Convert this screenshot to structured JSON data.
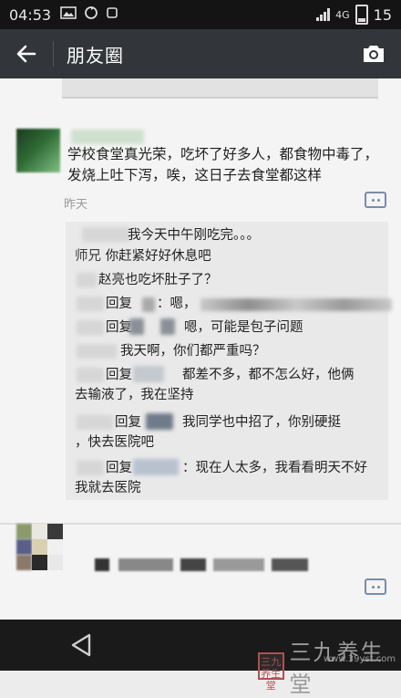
{
  "status_bar": {
    "time": "04:53",
    "battery": "15"
  },
  "action_bar": {
    "title": "朋友圈"
  },
  "post": {
    "text": "学校食堂真光荣，吃坏了好多人，都食物中毒了，发烧上吐下泻，唉，这日子去食堂都这样",
    "time": "昨天",
    "comments": [
      {
        "text": "我今天中午刚吃完。。。"
      },
      {
        "user": "师兄",
        "text": "你赶紧好好休息吧"
      },
      {
        "text": "赵亮也吃坏肚子了？"
      },
      {
        "reply": "回复",
        "text": "：嗯，"
      },
      {
        "reply": "回复",
        "text": "嗯，可能是包子问题"
      },
      {
        "text": "我天啊，你们都严重吗？"
      },
      {
        "reply": "回复",
        "text": "都差不多，都不怎么好，他俩"
      },
      {
        "text": "去输液了，我在坚持"
      },
      {
        "reply": "回复",
        "text": "我同学也中招了，你别硬挺"
      },
      {
        "text": "，快去医院吧"
      },
      {
        "reply": "回复",
        "text": "：现在人太多，我看看明天不好"
      },
      {
        "text": "我就去医院"
      }
    ]
  },
  "watermark": {
    "badge": "三九养生堂",
    "text": "三九养生堂",
    "url": "www.39yst.com"
  },
  "colors": {
    "status_bar_bg": "#141414",
    "action_bar_bg": "#323539",
    "comment_box_bg": "#e9e9e9",
    "link_blue": "#7a8ca8"
  }
}
